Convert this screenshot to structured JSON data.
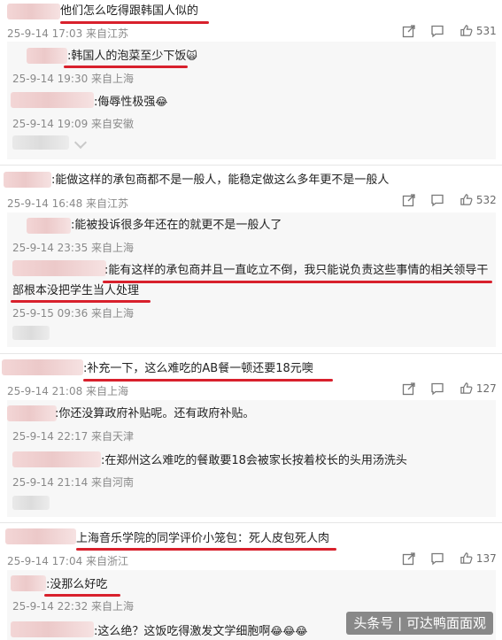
{
  "comments": [
    {
      "text": "他们怎么吃得跟韩国人似的",
      "meta": "25-9-14 17:03 来自江苏",
      "likes": "531"
    },
    {
      "text": ":韩国人的泡菜至少下饭",
      "emoji": "🙀",
      "meta": "25-9-14 19:30 来自上海"
    },
    {
      "text": ":侮辱性极强",
      "emoji": "😂",
      "meta": "25-9-14 19:09 来自安徽"
    },
    {
      "text": ":能做这样的承包商都不是一般人，能稳定做这么多年更不是一般人",
      "meta": "25-9-14 16:48 来自江苏",
      "likes": "532"
    },
    {
      "text": ":能被投诉很多年还在的就更不是一般人了",
      "meta": "25-9-14 23:35 来自上海"
    },
    {
      "text": ":能有这样的承包商并且一直屹立不倒，我只能说负责这些事情的相关领导干",
      "text2": "部根本没把学生当人处理",
      "meta": "25-9-15 09:36 来自上海"
    },
    {
      "text": ":补充一下，这么难吃的AB餐一顿还要18元噢",
      "meta": "25-9-14 21:08 来自上海",
      "likes": "127"
    },
    {
      "text": ":你还没算政府补贴呢。还有政府补贴。",
      "meta": "25-9-14 22:17 来自天津"
    },
    {
      "text": ":在郑州这么难吃的餐敢要18会被家长按着校长的头用汤洗头",
      "meta": "25-9-14 21:14 来自河南"
    },
    {
      "text": "上海音乐学院的同学评价小笼包：死人皮包死人肉",
      "meta": "25-9-14 17:04 来自浙江",
      "likes": "137"
    },
    {
      "text": ":没那么好吃",
      "meta": "25-9-14 22:32 来自上海"
    },
    {
      "text": ":这么绝？这饭吃得激发文学细胞啊",
      "emoji": "😂😂😂"
    }
  ],
  "icons": {
    "share": "share-icon",
    "comment": "comment-icon",
    "like": "thumbs-up-icon"
  },
  "watermark": "头条号 | 可达鸭面面观",
  "colors": {
    "underline": "#d8202c",
    "meta": "#8a8a8a",
    "reply_bg": "#f7f7f7"
  }
}
